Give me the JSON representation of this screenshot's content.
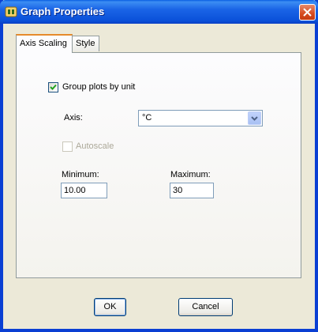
{
  "window": {
    "title": "Graph Properties"
  },
  "tabs": [
    {
      "label": "Axis Scaling",
      "active": true
    },
    {
      "label": "Style",
      "active": false
    }
  ],
  "axis_scaling": {
    "group_plots": {
      "label": "Group plots by unit",
      "checked": true
    },
    "axis": {
      "label": "Axis:",
      "selected": "°C"
    },
    "autoscale": {
      "label": "Autoscale",
      "checked": false,
      "enabled": false
    },
    "minimum": {
      "label": "Minimum:",
      "value": "10.00"
    },
    "maximum": {
      "label": "Maximum:",
      "value": "30"
    }
  },
  "buttons": {
    "ok": "OK",
    "cancel": "Cancel"
  },
  "icons": {
    "app": "app-icon",
    "close": "close-icon",
    "check": "checkmark-icon",
    "dropdown": "chevron-down-icon"
  },
  "colors": {
    "titlebar": "#0a50d9",
    "dialog_bg": "#ece9d8",
    "close": "#d64b20",
    "tab_accent": "#e68b2c"
  }
}
